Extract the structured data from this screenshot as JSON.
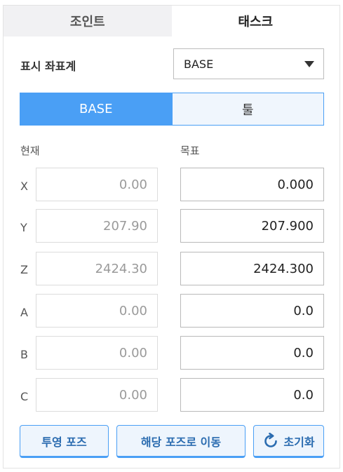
{
  "tabs": [
    {
      "label": "조인트",
      "active": false
    },
    {
      "label": "태스크",
      "active": true
    }
  ],
  "coordinate_system": {
    "label": "표시 좌표계",
    "selected": "BASE"
  },
  "frame_toggle": {
    "options": [
      "BASE",
      "툴"
    ],
    "selected": "BASE"
  },
  "columns": {
    "current": "현재",
    "target": "목표"
  },
  "rows": [
    {
      "axis": "X",
      "current": "0.00",
      "target": "0.000"
    },
    {
      "axis": "Y",
      "current": "207.90",
      "target": "207.900"
    },
    {
      "axis": "Z",
      "current": "2424.30",
      "target": "2424.300"
    },
    {
      "axis": "A",
      "current": "0.00",
      "target": "0.0"
    },
    {
      "axis": "B",
      "current": "0.00",
      "target": "0.0"
    },
    {
      "axis": "C",
      "current": "0.00",
      "target": "0.0"
    }
  ],
  "buttons": {
    "project_pose": "투영 포즈",
    "move_to_pose": "해당 포즈로 이동",
    "reset": "초기화",
    "reset_icon": "refresh-icon"
  },
  "colors": {
    "accent": "#4a9ff5",
    "accent_text": "#2b6cb0",
    "inactive_tab": "#f1f1f3"
  }
}
